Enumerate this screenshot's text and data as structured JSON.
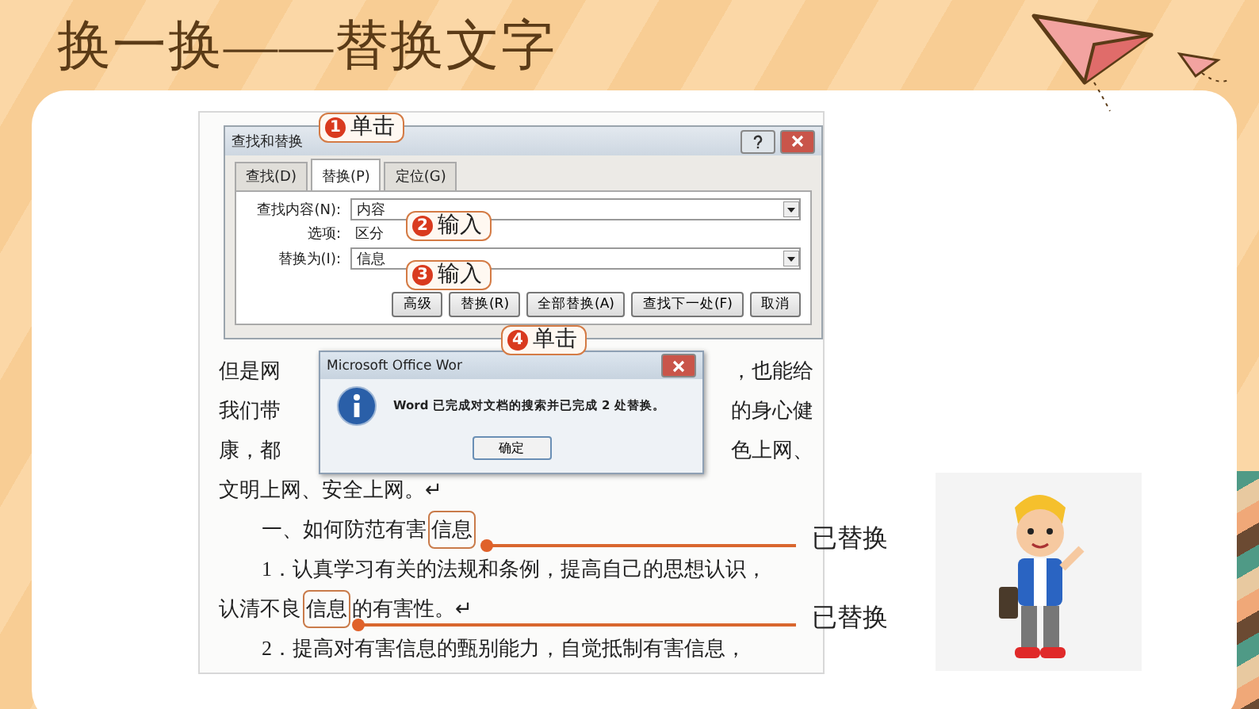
{
  "title": "换一换——替换文字",
  "find_replace_dialog": {
    "title": "查找和替换",
    "tabs": [
      {
        "label": "查找(D)",
        "selected": false
      },
      {
        "label": "替换(P)",
        "selected": true
      },
      {
        "label": "定位(G)",
        "selected": false
      }
    ],
    "fields": [
      {
        "label": "查找内容(N):",
        "value": "内容"
      },
      {
        "label": "选项:",
        "value": "区分",
        "kind": "info"
      },
      {
        "label": "替换为(I):",
        "value": "信息"
      }
    ],
    "buttons": [
      "高级",
      "替换(R)",
      "全部替换(A)",
      "查找下一处(F)",
      "取消"
    ]
  },
  "message_box": {
    "title": "Microsoft Office Wor",
    "message": "Word 已完成对文档的搜索并已完成 2 处替换。",
    "button": "确定"
  },
  "document_lines": [
    {
      "indent": false,
      "segments": [
        {
          "text": "但是网",
          "highlight": false
        }
      ],
      "right": "，也能给"
    },
    {
      "indent": false,
      "segments": [
        {
          "text": "我们带",
          "highlight": false
        }
      ],
      "right": "的身心健"
    },
    {
      "indent": false,
      "segments": [
        {
          "text": "康，都",
          "highlight": false
        }
      ],
      "right": "色上网、"
    },
    {
      "indent": false,
      "segments": [
        {
          "text": "文明上网、安全上网。↵",
          "highlight": false
        }
      ]
    },
    {
      "indent": true,
      "segments": [
        {
          "text": "一、如何防范有害",
          "highlight": false
        },
        {
          "text": "信息",
          "highlight": true
        }
      ]
    },
    {
      "indent": true,
      "segments": [
        {
          "text": "1．认真学习有关的法规和条例，提高自己的思想认识，",
          "highlight": false
        }
      ]
    },
    {
      "indent": false,
      "segments": [
        {
          "text": "认清不良",
          "highlight": false
        },
        {
          "text": "信息",
          "highlight": true
        },
        {
          "text": "的有害性。↵",
          "highlight": false
        }
      ]
    },
    {
      "indent": true,
      "segments": [
        {
          "text": "2．提高对有害信息的甄别能力，自觉抵制有害信息，",
          "highlight": false
        }
      ]
    }
  ],
  "callouts": [
    {
      "number": "1",
      "text": "单击"
    },
    {
      "number": "2",
      "text": "输入"
    },
    {
      "number": "3",
      "text": "输入"
    },
    {
      "number": "4",
      "text": "单击"
    }
  ],
  "annotations": [
    "已替换",
    "已替换"
  ]
}
